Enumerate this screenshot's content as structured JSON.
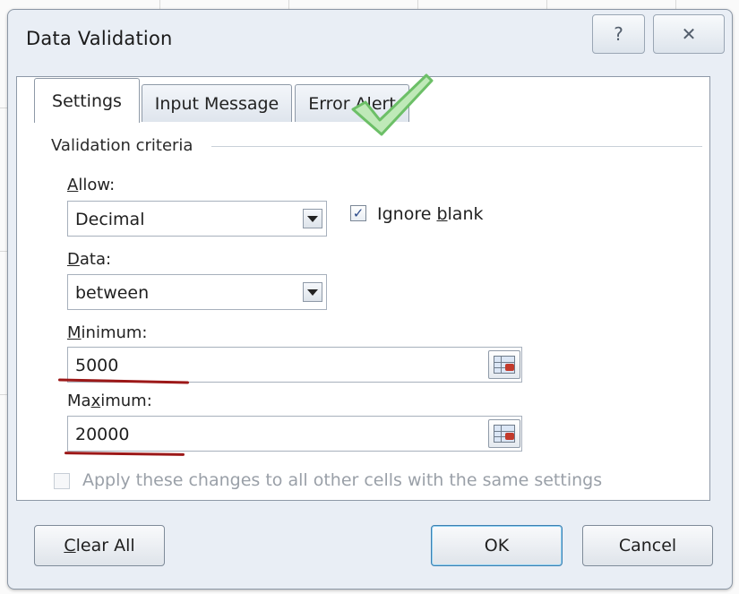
{
  "window": {
    "title": "Data Validation",
    "help_glyph": "?",
    "close_glyph": "✕"
  },
  "tabs": [
    {
      "label": "Settings",
      "active": true
    },
    {
      "label": "Input Message",
      "active": false
    },
    {
      "label": "Error Alert",
      "active": false
    }
  ],
  "criteria": {
    "group_label": "Validation criteria",
    "allow": {
      "label_u": "A",
      "label_rest": "llow:",
      "value": "Decimal"
    },
    "ignore_blank": {
      "label_pre": "Ignore ",
      "label_u": "b",
      "label_rest": "lank",
      "checked": true,
      "check_glyph": "✓"
    },
    "data": {
      "label_u": "D",
      "label_rest": "ata:",
      "value": "between"
    },
    "minimum": {
      "label_u": "M",
      "label_rest": "inimum:",
      "value": "5000"
    },
    "maximum": {
      "label_pre": "Ma",
      "label_u": "x",
      "label_rest": "imum:",
      "value": "20000"
    }
  },
  "apply_all": {
    "label": "Apply these changes to all other cells with the same settings",
    "checked": false,
    "enabled": false
  },
  "buttons": {
    "clear_u": "C",
    "clear_rest": "lear All",
    "ok": "OK",
    "cancel": "Cancel"
  },
  "colors": {
    "dialog_bg": "#e9eef5",
    "annotation_underline": "#9c1818",
    "annotation_checkmark": "#7fcf7a",
    "ok_focus": "#3c7fb1"
  },
  "annotations": [
    "checkmark-over-error-alert-tab",
    "underline-minimum",
    "underline-maximum"
  ]
}
